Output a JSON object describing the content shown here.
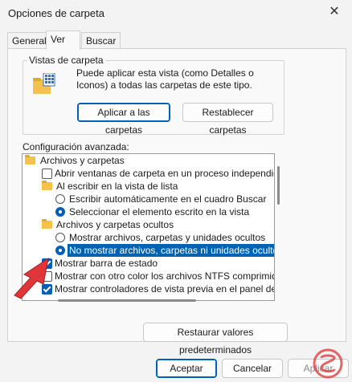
{
  "window": {
    "title": "Opciones de carpeta",
    "close_glyph": "✕"
  },
  "tabs": [
    {
      "label": "General",
      "active": false
    },
    {
      "label": "Ver",
      "active": true
    },
    {
      "label": "Buscar",
      "active": false
    }
  ],
  "folder_views": {
    "legend": "Vistas de carpeta",
    "description": "Puede aplicar esta vista (como Detalles o Iconos) a todas las carpetas de este tipo.",
    "apply_button": "Aplicar a las carpetas",
    "reset_button": "Restablecer carpetas"
  },
  "advanced": {
    "label": "Configuración avanzada:",
    "items": [
      {
        "kind": "folder",
        "label": "Archivos y carpetas"
      },
      {
        "kind": "check",
        "checked": false,
        "label": "Abrir ventanas de carpeta  en un proceso independiente"
      },
      {
        "kind": "folder",
        "label": "Al escribir en la vista de lista"
      },
      {
        "kind": "radio",
        "checked": false,
        "label": "Escribir automáticamente en el cuadro Buscar"
      },
      {
        "kind": "radio",
        "checked": true,
        "label": "Seleccionar el elemento escrito en la vista"
      },
      {
        "kind": "folder",
        "label": "Archivos y carpetas ocultos"
      },
      {
        "kind": "radio",
        "checked": false,
        "label": "Mostrar archivos, carpetas y unidades ocultos"
      },
      {
        "kind": "radio",
        "checked": true,
        "selected": true,
        "label": "No mostrar archivos, carpetas ni unidades ocultos"
      },
      {
        "kind": "check",
        "checked": true,
        "label": "Mostrar barra de estado"
      },
      {
        "kind": "check",
        "checked": false,
        "label": "Mostrar con otro color los archivos NTFS comprimidos o c"
      },
      {
        "kind": "check",
        "checked": true,
        "label": "Mostrar controladores de vista previa en el panel de vista"
      }
    ],
    "restore_button": "Restaurar valores predeterminados"
  },
  "footer": {
    "ok": "Aceptar",
    "cancel": "Cancelar",
    "apply": "Aplicar"
  },
  "colors": {
    "accent": "#005fb8",
    "selection": "#0063b1",
    "arrow": "#e0363a"
  },
  "icons": [
    "close-icon",
    "folder-view-icon",
    "folder-icon",
    "arrow-annotation-icon",
    "watermark-logo"
  ]
}
